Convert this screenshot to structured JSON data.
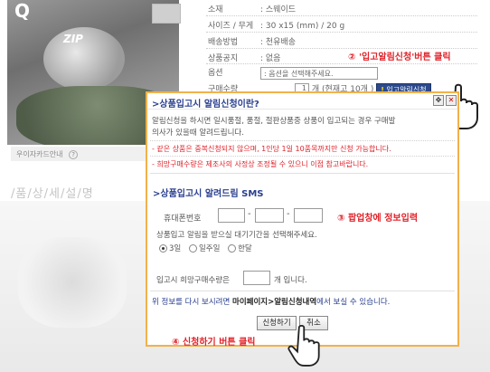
{
  "product": {
    "specs": [
      {
        "label": "소재",
        "value": ": 스웨이드"
      },
      {
        "label": "사이즈 / 무게",
        "value": ": 30 x15 (mm)  /   20 g"
      },
      {
        "label": "배송방법",
        "value": ": 천유배송"
      },
      {
        "label": "상품공지",
        "value": ": 없음"
      }
    ],
    "option_label": "옵션",
    "option_placeholder": ": 옵션을 선택해주세요.",
    "qty_label": "구매수량",
    "qty_value": "1",
    "qty_suffix": "개 (현재고 10개 )",
    "stock_button_mark": "!",
    "stock_button": "입고알림신청",
    "photo_caption": "우이자카드안내",
    "photo_caption_icon": "?",
    "photo_text": "ZIP",
    "photo_q": "Q"
  },
  "detail_title": "/품/상/세/설/명",
  "callouts": {
    "c2": "② '입고알림신청'버튼 클릭",
    "c3": "③ 팝업창에 정보입력",
    "c4": "④ 신청하기 버튼 클릭"
  },
  "popup": {
    "title": ">상품입고시 알림신청이란?",
    "desc1": "알림신청을 하시면 일시품절, 품절, 절판상품중 상품이 입고되는 경우 구매발",
    "desc2": "의사가 있을때 알려드립니다.",
    "note1": "- 같은 상품은 중복신청되지 않으며, 1인당 1일 10품목까지만 신청 가능합니다.",
    "note2": "- 희망구매수량은 제조사의 사정상 조정될 수 있으니 이점 참고바랍니다.",
    "sms_title": ">상품입고시 알려드림 SMS",
    "phone_label": "휴대폰번호",
    "wait_label": "상품입고 알림을 받으실 대기기간을 선택해주세요.",
    "radio_options": [
      "3일",
      "일주일",
      "한달"
    ],
    "radio_selected": "3일",
    "qty_prefix": "입고시 희망구매수량은",
    "qty_suffix": "개 입니다.",
    "info_prefix": "위 정보를 다시 보시려면",
    "info_link": "마이페이지>알림신청내역",
    "info_suffix": "에서 보실 수 있습니다.",
    "submit": "신청하기",
    "cancel": "취소"
  },
  "colors": {
    "accent": "#e0222a",
    "title_blue": "#2a3f8f",
    "popup_border": "#f2b14a",
    "stock_button_bg": "#2c4a8c"
  },
  "icons": [
    "move-icon",
    "close-icon",
    "pointer-hand-icon",
    "help-circle-icon"
  ]
}
